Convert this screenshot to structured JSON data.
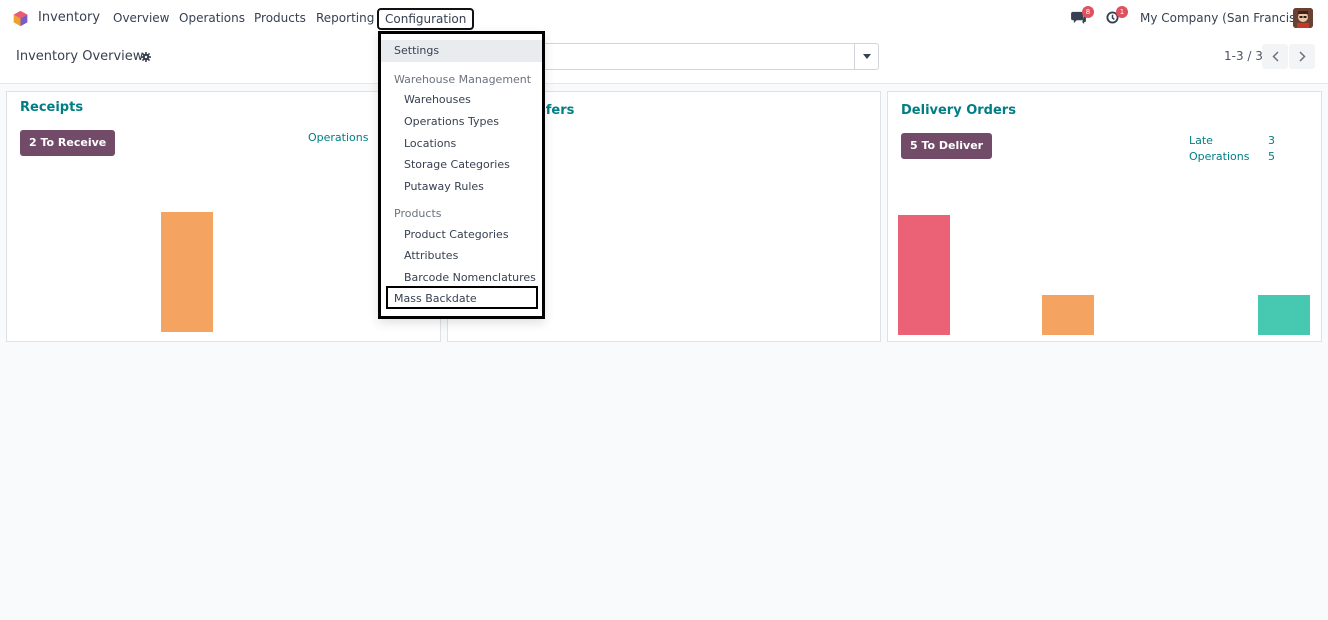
{
  "navbar": {
    "app_name": "Inventory",
    "menu": [
      "Overview",
      "Operations",
      "Products",
      "Reporting",
      "Configuration"
    ],
    "messages_count": "8",
    "activities_count": "1",
    "company": "My Company (San Francisco)"
  },
  "control": {
    "title": "Inventory Overview",
    "pager": "1-3 / 3"
  },
  "cards": {
    "receipts": {
      "title": "Receipts",
      "button": "2 To Receive",
      "stat_label": "Operations"
    },
    "internal": {
      "title_visible": "sfers"
    },
    "delivery": {
      "title": "Delivery Orders",
      "button": "5 To Deliver",
      "stats": [
        {
          "label": "Late",
          "value": "3"
        },
        {
          "label": "Operations",
          "value": "5"
        }
      ]
    }
  },
  "colors": {
    "accent": "#017e84",
    "primary": "#714b67",
    "bar_orange": "#f4a460",
    "bar_red": "#eb6277",
    "bar_teal": "#47c8b1"
  },
  "dropdown": {
    "settings": "Settings",
    "section_warehouse": "Warehouse Management",
    "warehouse_items": [
      "Warehouses",
      "Operations Types",
      "Locations",
      "Storage Categories",
      "Putaway Rules"
    ],
    "section_products": "Products",
    "product_items": [
      "Product Categories",
      "Attributes",
      "Barcode Nomenclatures"
    ],
    "mass_backdate": "Mass Backdate"
  }
}
